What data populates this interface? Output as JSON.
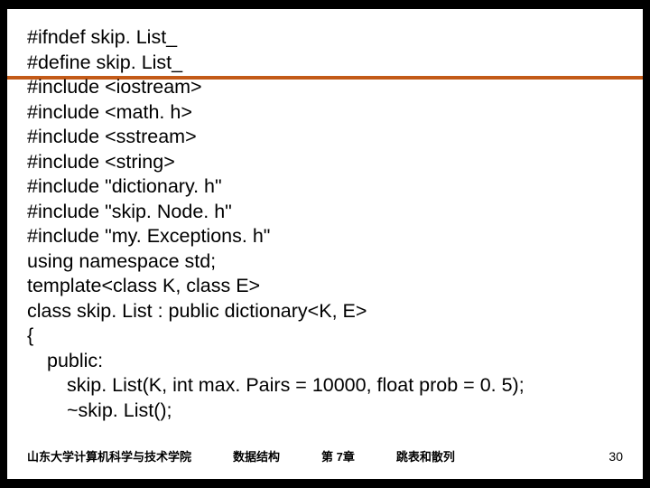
{
  "code": {
    "l1": "#ifndef skip. List_",
    "l2": "#define skip. List_",
    "l3": "#include <iostream>",
    "l4": "#include <math. h>",
    "l5": "#include <sstream>",
    "l6": "#include <string>",
    "l7": "#include \"dictionary. h\"",
    "l8": "#include \"skip. Node. h\"",
    "l9": "#include \"my. Exceptions. h\"",
    "l10": "using namespace std;",
    "l11": "template<class K, class E>",
    "l12": "class skip. List : public dictionary<K, E>",
    "l13": "{",
    "l14": "public:",
    "l15": "skip. List(K, int max. Pairs = 10000, float prob = 0. 5);",
    "l16": "~skip. List();"
  },
  "footer": {
    "affiliation": "山东大学计算机科学与技术学院",
    "subject": "数据结构",
    "chapter": "第 7章",
    "topic": "跳表和散列",
    "page": "30"
  }
}
